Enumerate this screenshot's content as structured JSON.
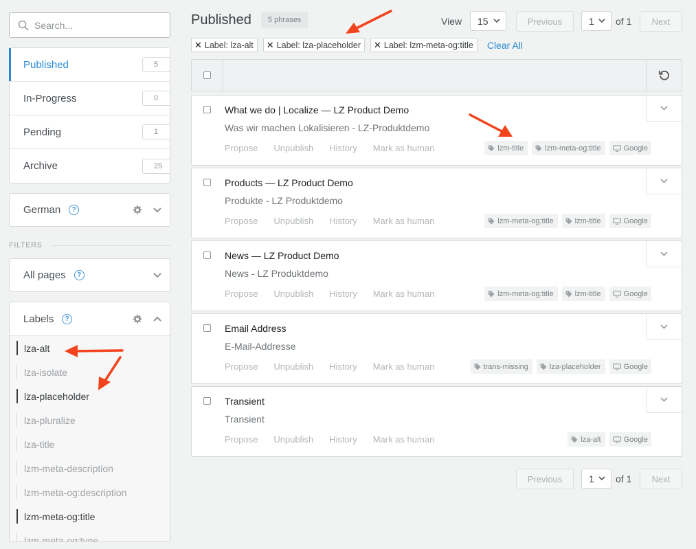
{
  "search": {
    "placeholder": "Search..."
  },
  "statuses": [
    {
      "label": "Published",
      "count": "5",
      "active": true
    },
    {
      "label": "In-Progress",
      "count": "0",
      "active": false
    },
    {
      "label": "Pending",
      "count": "1",
      "active": false
    },
    {
      "label": "Archive",
      "count": "25",
      "active": false
    }
  ],
  "language": {
    "label": "German"
  },
  "filters": {
    "heading": "FILTERS"
  },
  "pages_filter": {
    "label": "All pages"
  },
  "labels_panel": {
    "label": "Labels",
    "items": [
      {
        "name": "lza-alt",
        "selected": true
      },
      {
        "name": "lza-isolate",
        "selected": false
      },
      {
        "name": "lza-placeholder",
        "selected": true
      },
      {
        "name": "lza-pluralize",
        "selected": false
      },
      {
        "name": "lza-title",
        "selected": false
      },
      {
        "name": "lzm-meta-description",
        "selected": false
      },
      {
        "name": "lzm-meta-og:description",
        "selected": false
      },
      {
        "name": "lzm-meta-og:title",
        "selected": true
      },
      {
        "name": "lzm-meta-og:type",
        "selected": false
      }
    ]
  },
  "header": {
    "title": "Published",
    "phrase_count": "5 phrases",
    "view_label": "View",
    "view_value": "15",
    "previous": "Previous",
    "page_value": "1",
    "of_label": "of 1",
    "next": "Next"
  },
  "active_filters": {
    "chips": [
      "Label: lza-alt",
      "Label: lza-placeholder",
      "Label: lzm-meta-og:title"
    ],
    "clear_all": "Clear All"
  },
  "phrase_actions": [
    "Propose",
    "Unpublish",
    "History",
    "Mark as human"
  ],
  "machine_label": "Google",
  "phrases": [
    {
      "source": "What we do | Localize — LZ Product Demo",
      "target": "Was wir machen Lokalisieren - LZ-Produktdemo",
      "tags": [
        "lzm-title",
        "lzm-meta-og:title"
      ]
    },
    {
      "source": "Products — LZ Product Demo",
      "target": "Produkte - LZ Produktdemo",
      "tags": [
        "lzm-meta-og:title",
        "lzm-title"
      ]
    },
    {
      "source": "News — LZ Product Demo",
      "target": "News - LZ Produktdemo",
      "tags": [
        "lzm-meta-og:title",
        "lzm-title"
      ]
    },
    {
      "source": "Email Address",
      "target": "E-Mail-Addresse",
      "tags": [
        "trans-missing",
        "lza-placeholder"
      ]
    },
    {
      "source": "Transient",
      "target": "Transient",
      "tags": [
        "lza-alt"
      ]
    }
  ],
  "footer": {
    "previous": "Previous",
    "page_value": "1",
    "of_label": "of 1",
    "next": "Next"
  },
  "colors": {
    "accent": "#2a8ad6",
    "annotation_arrow": "#f2431c"
  }
}
